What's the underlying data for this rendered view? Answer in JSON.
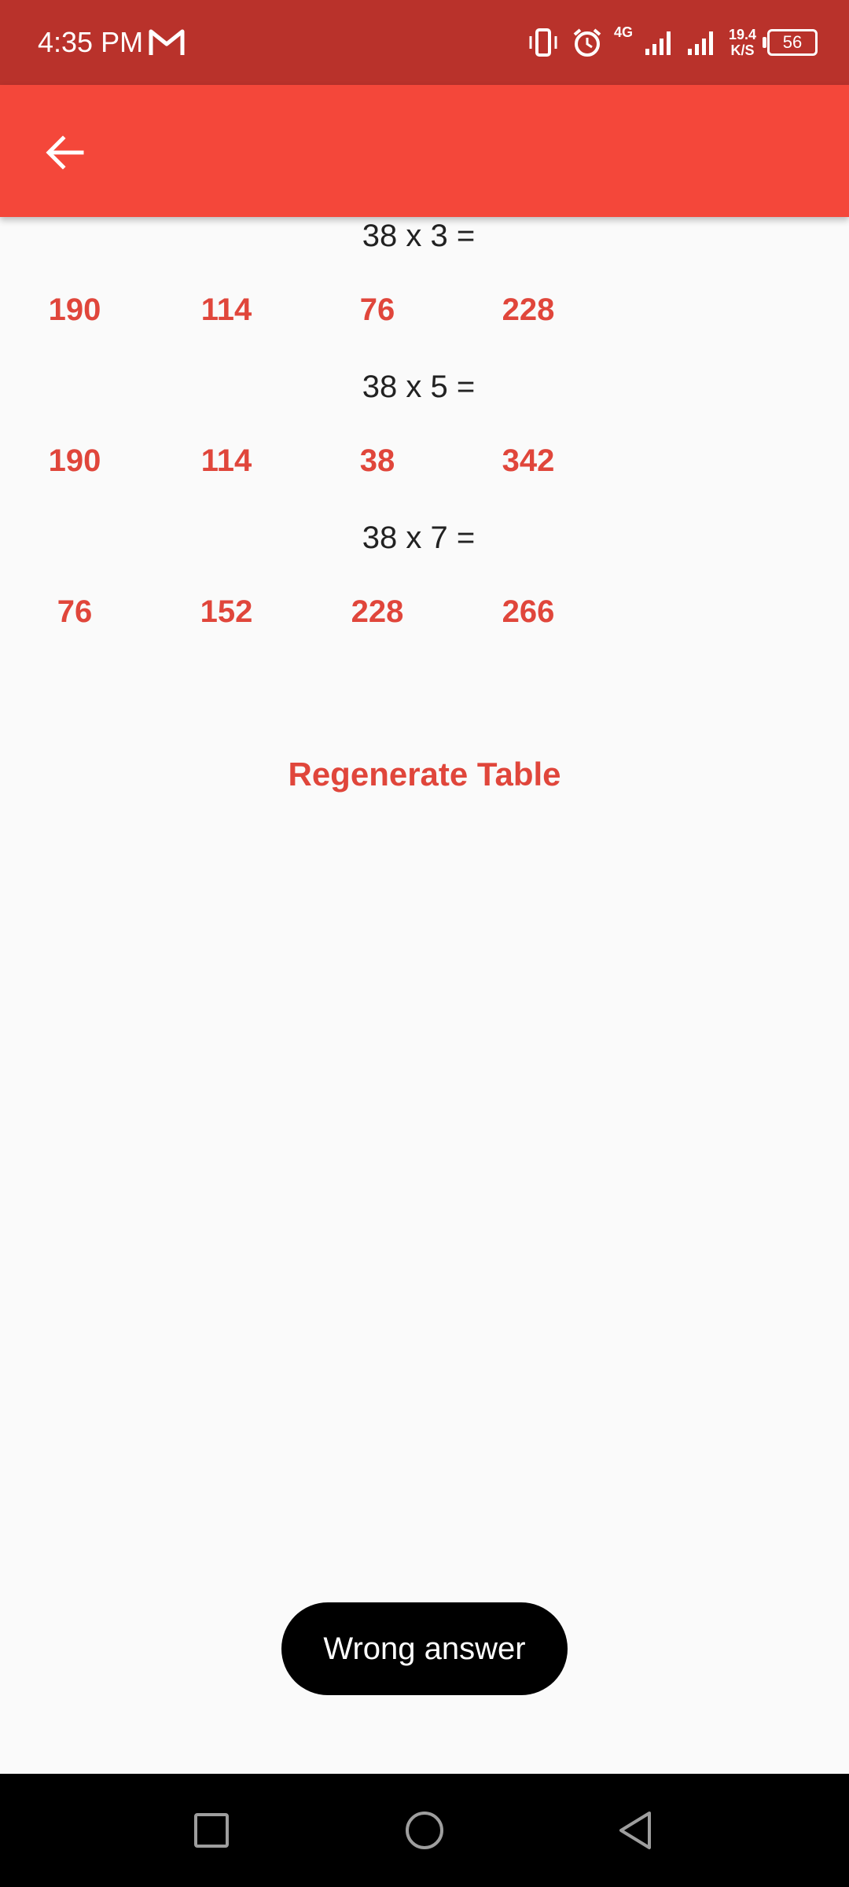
{
  "status_bar": {
    "time": "4:35 PM",
    "network_type": "4G",
    "speed_value": "19.4",
    "speed_unit": "K/S",
    "battery": "56"
  },
  "app_bar": {
    "back_icon": "arrow-left-icon"
  },
  "quiz": {
    "questions": [
      {
        "prompt": "38 x 3 =",
        "options": [
          "190",
          "114",
          "76",
          "228"
        ]
      },
      {
        "prompt": "38 x 5 =",
        "options": [
          "190",
          "114",
          "38",
          "342"
        ]
      },
      {
        "prompt": "38 x 7 =",
        "options": [
          "76",
          "152",
          "228",
          "266"
        ]
      }
    ],
    "regenerate_label": "Regenerate Table"
  },
  "toast": {
    "message": "Wrong answer"
  },
  "colors": {
    "status_bar": "#b9322b",
    "app_bar": "#f4473a",
    "accent_text": "#e0463b",
    "background": "#fafafa"
  }
}
